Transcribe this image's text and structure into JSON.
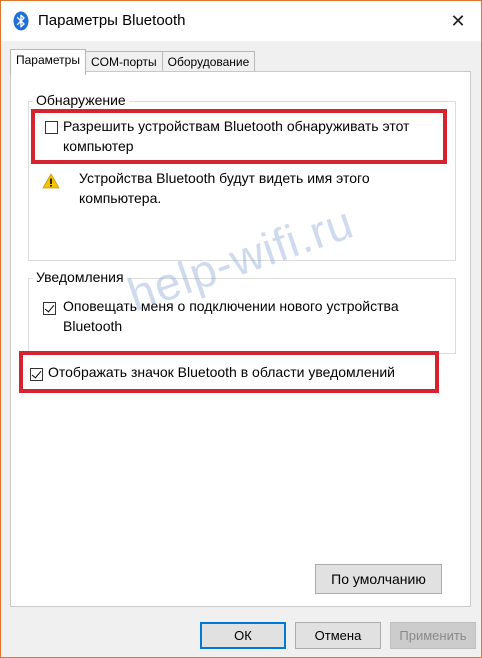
{
  "window": {
    "title": "Параметры Bluetooth",
    "close_glyph": "✕",
    "icon": "bluetooth-icon"
  },
  "tabs": [
    {
      "label": "Параметры",
      "active": true
    },
    {
      "label": "COM-порты",
      "active": false
    },
    {
      "label": "Оборудование",
      "active": false
    }
  ],
  "discovery": {
    "title": "Обнаружение",
    "allow_discovery_label": "Разрешить устройствам Bluetooth обнаруживать этот компьютер",
    "allow_discovery_checked": false,
    "warning_text": "Устройства Bluetooth будут видеть имя этого компьютера."
  },
  "notifications": {
    "title": "Уведомления",
    "notify_connect_label": "Оповещать меня о подключении нового устройства Bluetooth",
    "notify_connect_checked": true
  },
  "show_tray_icon": {
    "label": "Отображать значок Bluetooth в области уведомлений",
    "checked": true
  },
  "buttons": {
    "defaults": "По умолчанию",
    "ok": "ОК",
    "cancel": "Отмена",
    "apply": "Применить"
  },
  "watermark": "help-wifi.ru",
  "colors": {
    "highlight": "#d5232f",
    "accent": "#0078d7",
    "bluetooth": "#1e6fd6",
    "warning": "#f3c200"
  }
}
